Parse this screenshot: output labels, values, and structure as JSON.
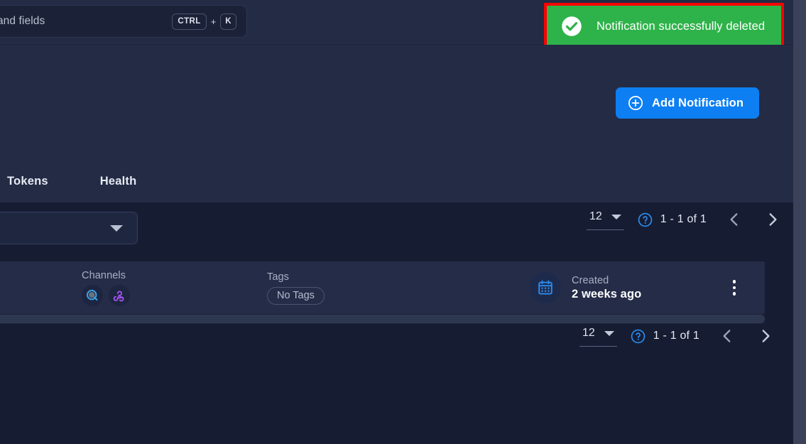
{
  "search": {
    "placeholder_visible": "ners and fields",
    "shortcut_key": "CTRL",
    "shortcut_plus": "+",
    "shortcut_letter": "K"
  },
  "toast": {
    "message": "Notification successfully deleted",
    "icon": "check-circle-icon",
    "background": "#2eb34a",
    "highlight_border": "#ff0000"
  },
  "header": {
    "add_button_label": "Add Notification",
    "add_button_icon": "plus-circle-icon",
    "accent": "#0d7ff2",
    "tabs": [
      {
        "label": "Tokens",
        "name": "tab-tokens"
      },
      {
        "label": "Health",
        "name": "tab-health"
      }
    ]
  },
  "toolbar": {
    "filter_value": "",
    "pagination_top": {
      "page_size": "12",
      "range": "1 - 1 of 1",
      "help_icon": "help-circle-icon",
      "prev_icon": "chevron-left-icon",
      "next_icon": "chevron-right-icon"
    },
    "pagination_bottom": {
      "page_size": "12",
      "range": "1 - 1 of 1",
      "help_icon": "help-circle-icon",
      "prev_icon": "chevron-left-icon",
      "next_icon": "chevron-right-icon"
    }
  },
  "table": {
    "rows": [
      {
        "channels_label": "Channels",
        "channels": [
          {
            "name": "opsgenie-channel-icon",
            "color": "#3aa0e8"
          },
          {
            "name": "webhook-channel-icon",
            "color": "#a855f7"
          }
        ],
        "tags_label": "Tags",
        "tags_value": "No Tags",
        "created_label": "Created",
        "created_value": "2 weeks ago",
        "created_icon": "calendar-icon",
        "menu_icon": "kebab-menu-icon"
      }
    ]
  }
}
